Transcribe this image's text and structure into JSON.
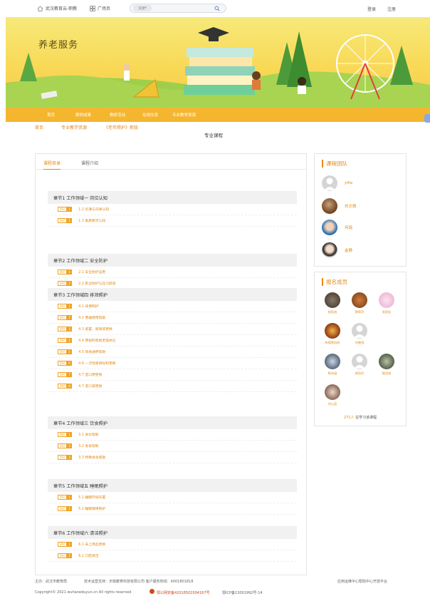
{
  "topbar": {
    "home": "武汉教育云-职教",
    "plaza": "广场页",
    "search_scope": "资源",
    "login": "登录",
    "register": "注册"
  },
  "banner": {
    "title": "养老服务"
  },
  "nav": [
    "首页",
    "案例成果",
    "教研活动",
    "在线交流",
    "专业教学资源"
  ],
  "breadcrumb": [
    "首页",
    "专业教学资源",
    "《老年照护》新版"
  ],
  "page_title": "专业课程",
  "tabs": {
    "catalog": "课程目录",
    "intro": "课程介绍"
  },
  "badge_label": "学时",
  "chapters": [
    {
      "title": "章节1 工作领域一 岗位认知",
      "lessons": [
        {
          "n": "1",
          "name": "1.2 伝薄与归事认知"
        },
        {
          "n": "2",
          "name": "1.3 素质要求认知"
        }
      ]
    },
    {
      "title": "章节2 工作领域二 安全防护",
      "lessons": [
        {
          "n": "1",
          "name": "2.1 安全防护运用"
        },
        {
          "n": "2",
          "name": "2.2 职业防护与压力舒适"
        }
      ]
    },
    {
      "title": "章节3 工作领域四 排泄照护",
      "lessons": [
        {
          "n": "1",
          "name": "4.1 排便照护"
        },
        {
          "n": "2",
          "name": "4.2 便器使用帮助"
        },
        {
          "n": "3",
          "name": "4.3 留置、尿尿袋更换"
        },
        {
          "n": "4",
          "name": "4.4 便秘时帮助老操休位"
        },
        {
          "n": "5",
          "name": "4.5 简易通便帮助"
        },
        {
          "n": "6",
          "name": "4.6 一次性尿裤纷和更换"
        },
        {
          "n": "7",
          "name": "4.7 造口便更换"
        },
        {
          "n": "8",
          "name": "4.7 造口袋更换"
        }
      ]
    },
    {
      "title": "章节4 工作领域三 饮食照护",
      "lessons": [
        {
          "n": "1",
          "name": "3.1 进水帮助"
        },
        {
          "n": "2",
          "name": "3.2 进食帮助"
        },
        {
          "n": "3",
          "name": "3.3 特殊进食帮助"
        }
      ]
    },
    {
      "title": "章节5 工作领域五 睡眠照护",
      "lessons": [
        {
          "n": "1",
          "name": "5.1 睡眠环境布置"
        },
        {
          "n": "2",
          "name": "5.2 睡眠障碍照护"
        }
      ]
    },
    {
      "title": "章节6 工作领域六 清洁照护",
      "lessons": [
        {
          "n": "1",
          "name": "6.1 床上用品更换"
        },
        {
          "n": "2",
          "name": "6.2 口腔清洁"
        }
      ]
    }
  ],
  "team": {
    "heading": "课程团队",
    "members": [
      "ylfw",
      "刘文佩",
      "何瑶",
      "金静"
    ]
  },
  "enrolled": {
    "heading": "报名成员",
    "members": [
      "程凯迪",
      "黎莉玲",
      "张思佳",
      "陈德等妈妈",
      "刘晓雨",
      "陈诗涵",
      "胡浩俭",
      "喻羽如",
      "刘心蕊"
    ],
    "count": "271人",
    "count_suffix": "在学习该课程"
  },
  "colors": {
    "accent": "#e58a13",
    "nav": "#f4b62f"
  },
  "footer": {
    "host": "主办：武汉市教育局",
    "support": "技术运营支持：天喻教育科技有限公司 客户服务热线：4001801818",
    "links": "应用运维中心帮助中心开放平台",
    "copyright": "Copyright© 2021 wuhaneduyun.cn All rights reserved",
    "police": "鄂公网安备42018502004167号",
    "icp": "鄂ICP备13001992号-14"
  }
}
